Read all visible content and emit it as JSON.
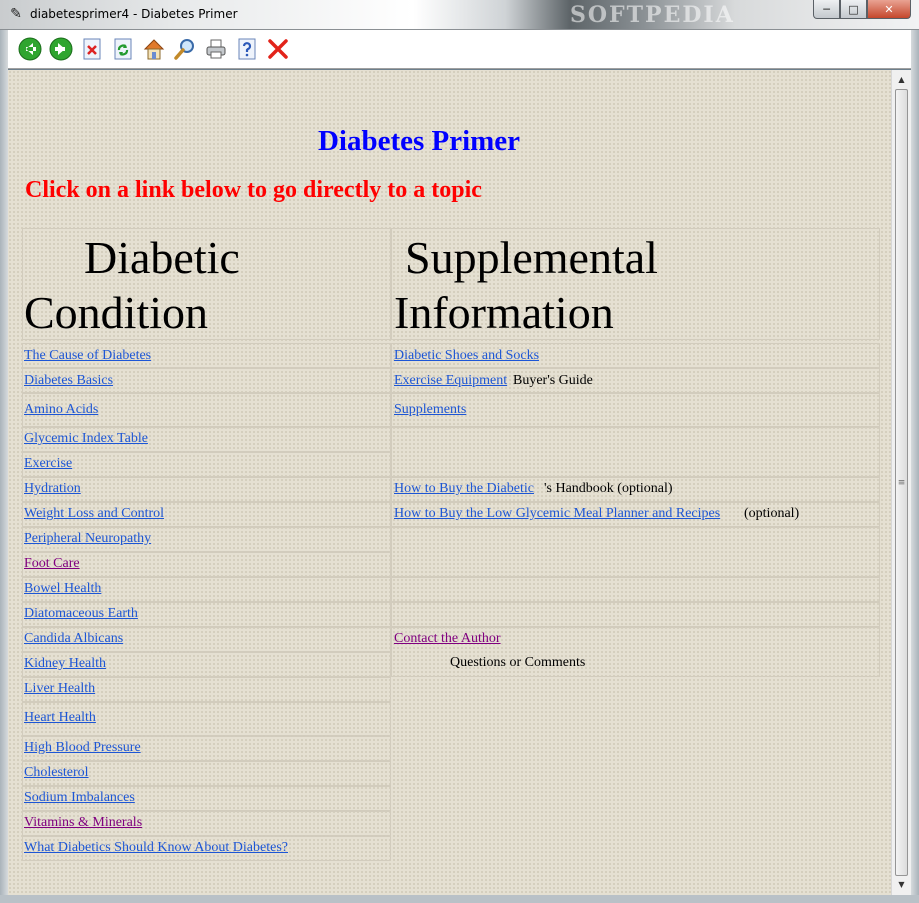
{
  "window": {
    "title": "diabetesprimer4 - Diabetes Primer",
    "watermark": "SOFTPEDIA",
    "buttons": {
      "minimize": "─",
      "maximize": "□",
      "close": "✕"
    }
  },
  "toolbar": {
    "buttons": [
      "back-icon",
      "forward-icon",
      "stop-icon",
      "refresh-icon",
      "home-icon",
      "search-icon",
      "print-icon",
      "help-icon",
      "exit-icon"
    ]
  },
  "page": {
    "title": "Diabetes Primer",
    "subtitle": "Click on a link below to go directly to a topic",
    "left_header_1": "Diabetic",
    "left_header_2": "Condition",
    "right_header_1": "Supplemental",
    "right_header_2": "Information"
  },
  "left_links": [
    "The Cause of Diabetes",
    "Diabetes Basics",
    "Amino Acids",
    "Glycemic Index Table",
    "Exercise",
    "Hydration",
    "Weight Loss and Control",
    "Peripheral Neuropathy",
    "Foot Care",
    "Bowel Health",
    "Diatomaceous Earth",
    "Candida Albicans",
    "Kidney Health",
    "Liver Health",
    "Heart Health",
    "High Blood Pressure",
    "Cholesterol",
    "Sodium Imbalances",
    "Vitamins & Minerals",
    "What Diabetics Should Know About Diabetes?"
  ],
  "right": {
    "shoes_link": "Diabetic Shoes and Socks",
    "exercise_link": "Exercise Equipment",
    "exercise_text": " Buyer's Guide",
    "supplements_link": "Supplements",
    "handbook_link": "How to Buy the Diabetic",
    "handbook_text": "'s Handbook  (optional)",
    "planner_link": "How to Buy the Low Glycemic Meal Planner and Recipes",
    "planner_text": " (optional)",
    "contact_link": "Contact the Author",
    "contact_text": "Questions or Comments"
  },
  "scrollbar": {
    "up": "▲",
    "down": "▼",
    "grip": "≡"
  },
  "colors": {
    "link": "#1d56d5",
    "visited": "#800080",
    "title": "#0000ff",
    "subtitle": "#ff0000",
    "background": "#e5e0d2"
  }
}
